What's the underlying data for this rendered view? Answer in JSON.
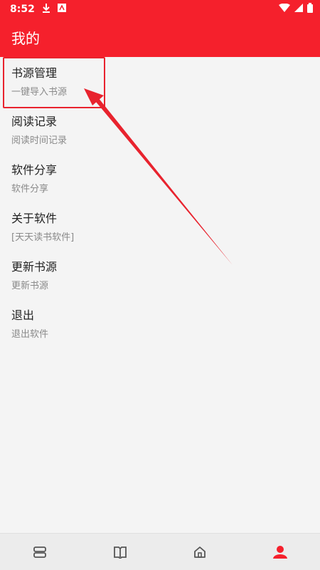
{
  "status": {
    "time": "8:52"
  },
  "header": {
    "title": "我的"
  },
  "menu": [
    {
      "title": "书源管理",
      "subtitle": "一键导入书源"
    },
    {
      "title": "阅读记录",
      "subtitle": "阅读时间记录"
    },
    {
      "title": "软件分享",
      "subtitle": "软件分享"
    },
    {
      "title": "关于软件",
      "subtitle": "[天天读书软件]"
    },
    {
      "title": "更新书源",
      "subtitle": "更新书源"
    },
    {
      "title": "退出",
      "subtitle": "退出软件"
    }
  ],
  "colors": {
    "accent": "#f5202c",
    "active_nav": "#f5202c",
    "nav_icon": "#555555"
  },
  "bottom_nav": [
    {
      "icon": "shelf-icon",
      "active": false
    },
    {
      "icon": "book-icon",
      "active": false
    },
    {
      "icon": "home-icon",
      "active": false
    },
    {
      "icon": "profile-icon",
      "active": true
    }
  ]
}
